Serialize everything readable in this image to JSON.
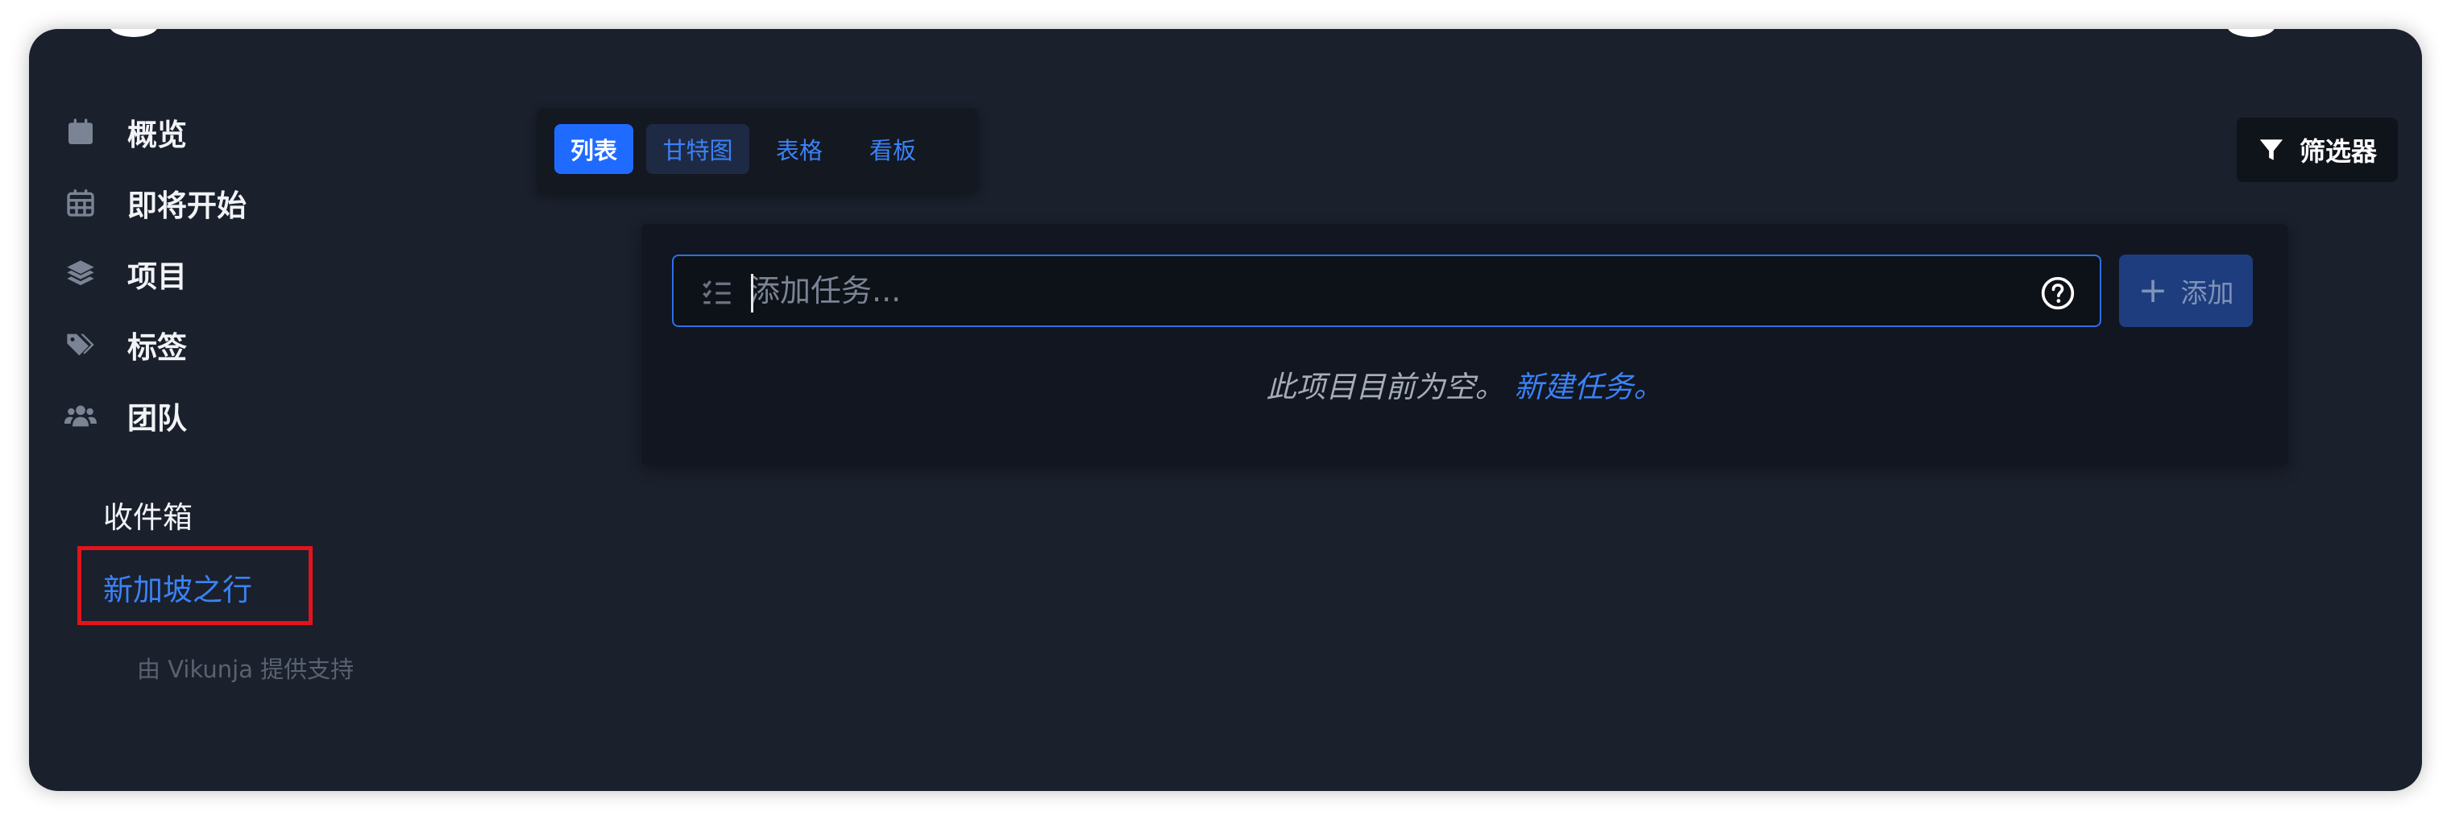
{
  "sidebar": {
    "nav": [
      {
        "label": "概览",
        "icon": "calendar-icon"
      },
      {
        "label": "即将开始",
        "icon": "calendar-grid-icon"
      },
      {
        "label": "项目",
        "icon": "layers-icon"
      },
      {
        "label": "标签",
        "icon": "tags-icon"
      },
      {
        "label": "团队",
        "icon": "users-icon"
      }
    ],
    "projects": [
      {
        "label": "收件箱"
      },
      {
        "label": "新加坡之行"
      }
    ],
    "powered_by": "由 Vikunja 提供支持"
  },
  "views": {
    "items": [
      {
        "label": "列表"
      },
      {
        "label": "甘特图"
      },
      {
        "label": "表格"
      },
      {
        "label": "看板"
      }
    ],
    "active": "列表"
  },
  "filter": {
    "label": "筛选器"
  },
  "task": {
    "placeholder": "添加任务...",
    "add_label": "添加",
    "empty_text": "此项目目前为空。",
    "empty_link": "新建任务。"
  },
  "colors": {
    "background": "#1a202c",
    "accent": "#3b82f6",
    "highlight": "#e3131c"
  }
}
